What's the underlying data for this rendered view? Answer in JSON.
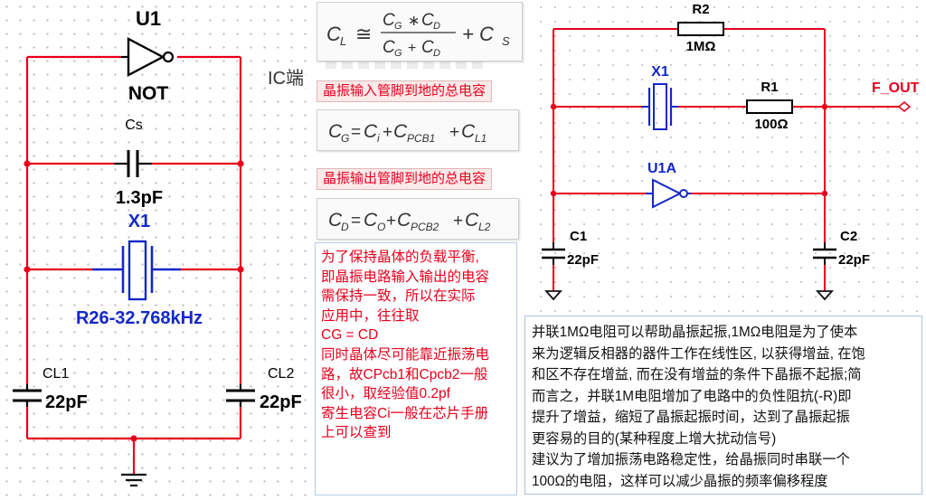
{
  "left_schematic": {
    "gate_ref": "U1",
    "gate_type": "NOT",
    "ic_side_label": "IC端",
    "cap_s_ref": "Cs",
    "cap_s_value": "1.3pF",
    "crystal_ref": "X1",
    "crystal_value": "R26-32.768kHz",
    "cl1_ref": "CL1",
    "cl1_value": "22pF",
    "cl2_ref": "CL2",
    "cl2_value": "22pF"
  },
  "formulas": {
    "load": {
      "lhs": "C",
      "lhs_sub": "L",
      "rel": "≅",
      "num_a": "C",
      "num_a_sub": "G",
      "num_op": "∗",
      "num_b": "C",
      "num_b_sub": "D",
      "den_a": "C",
      "den_a_sub": "G",
      "den_op": "+",
      "den_b": "C",
      "den_b_sub": "D",
      "tail": "+ C",
      "tail_sub": "S"
    },
    "input_label": "晶振输入管脚到地的总电容",
    "cg": {
      "lhs": "C",
      "lhs_sub": "G",
      "t1": "C",
      "t1_sub": "i",
      "t2": "C",
      "t2_sub": "PCB1",
      "t3": "C",
      "t3_sub": "L1"
    },
    "output_label": "晶振输出管脚到地的总电容",
    "cd": {
      "lhs": "C",
      "lhs_sub": "D",
      "t1": "C",
      "t1_sub": "O",
      "t2": "C",
      "t2_sub": "PCB2",
      "t3": "C",
      "t3_sub": "L2"
    }
  },
  "note_red": {
    "lines": [
      "为了保持晶体的负载平衡,",
      "即晶振电路输入输出的电容",
      "需保持一致，所以在实际",
      "应用中，往往取",
      "CG = CD",
      "同时晶体尽可能靠近振荡电",
      "路，故CPcb1和Cpcb2一般",
      "很小，取经验值0.2pf",
      "寄生电容Ci一般在芯片手册",
      "上可以查到"
    ]
  },
  "right_schematic": {
    "r2_ref": "R2",
    "r2_value": "1MΩ",
    "x1_ref": "X1",
    "r1_ref": "R1",
    "r1_value": "100Ω",
    "output_net": "F_OUT",
    "gate_ref": "U1A",
    "c1_ref": "C1",
    "c1_value": "22pF",
    "c2_ref": "C2",
    "c2_value": "22pF"
  },
  "note_black": {
    "lines": [
      "并联1MΩ电阻可以帮助晶振起振,1MΩ电阻是为了使本",
      "来为逻辑反相器的器件工作在线性区, 以获得增益, 在饱",
      "和区不存在增益, 而在没有增益的条件下晶振不起振;简",
      "而言之，并联1M电阻增加了电路中的负性阻抗(-R)即",
      "提升了增益，缩短了晶振起振时间，达到了晶振起振",
      "更容易的目的(某种程度上增大扰动信号)",
      "建议为了增加振荡电路稳定性，给晶振同时串联一个",
      "100Ω的电阻，这样可以减少晶振的频率偏移程度"
    ]
  },
  "colors": {
    "wire_red": "#e8001c",
    "component_blue": "#1428c8",
    "ground_black": "#111111",
    "net_label_red": "#e8001c"
  }
}
